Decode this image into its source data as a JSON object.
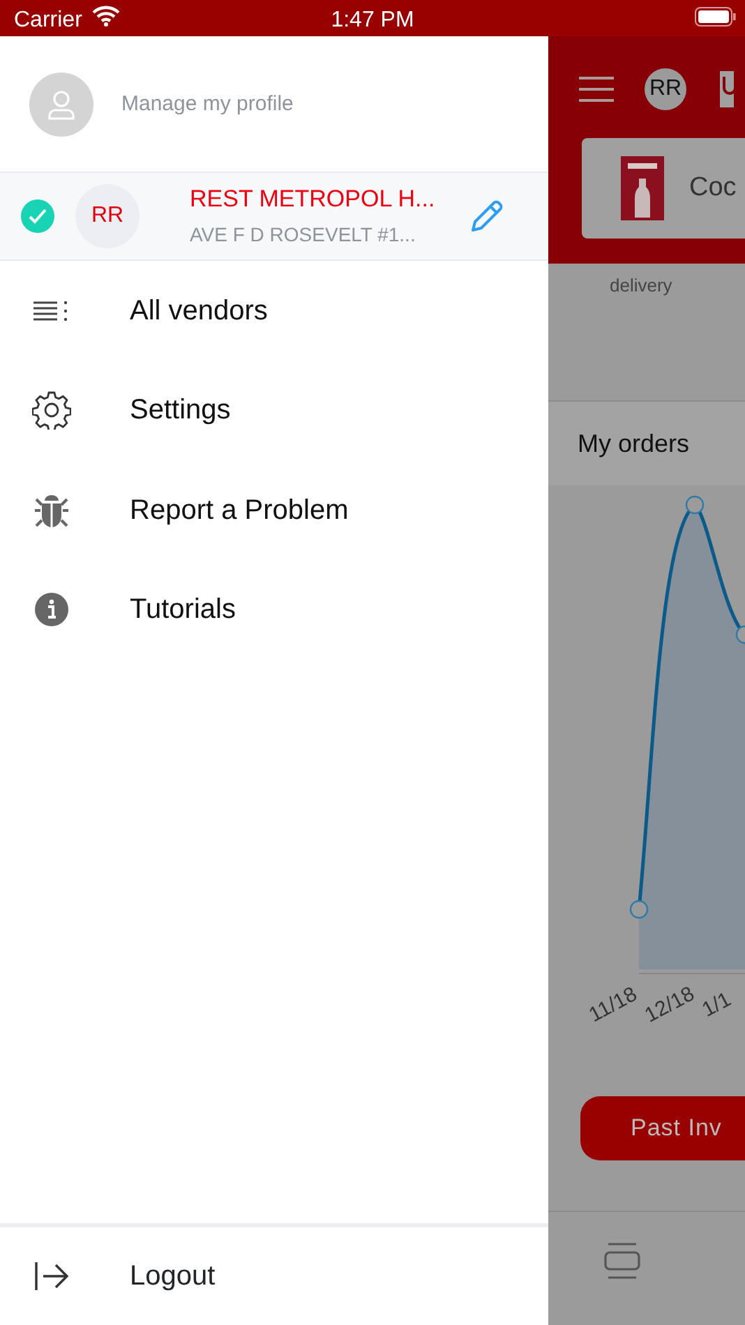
{
  "status_bar": {
    "carrier": "Carrier",
    "time": "1:47 PM"
  },
  "drawer": {
    "profile_link": "Manage my profile",
    "vendor": {
      "selected": true,
      "initials": "RR",
      "name": "REST METROPOL H...",
      "address": "AVE F D ROSEVELT #1..."
    },
    "items": [
      {
        "label": "All vendors",
        "kind": "list"
      },
      {
        "label": "Settings",
        "kind": "gear"
      },
      {
        "label": "Report a Problem",
        "kind": "bug"
      },
      {
        "label": "Tutorials",
        "kind": "info"
      }
    ],
    "logout": "Logout"
  },
  "background": {
    "avatar_initials": "RR",
    "card_title": "Coc",
    "caption": "delivery",
    "section_title": "My orders",
    "chart_labels": [
      "11/18",
      "12/18",
      "1/1"
    ],
    "button": "Past Inv"
  }
}
